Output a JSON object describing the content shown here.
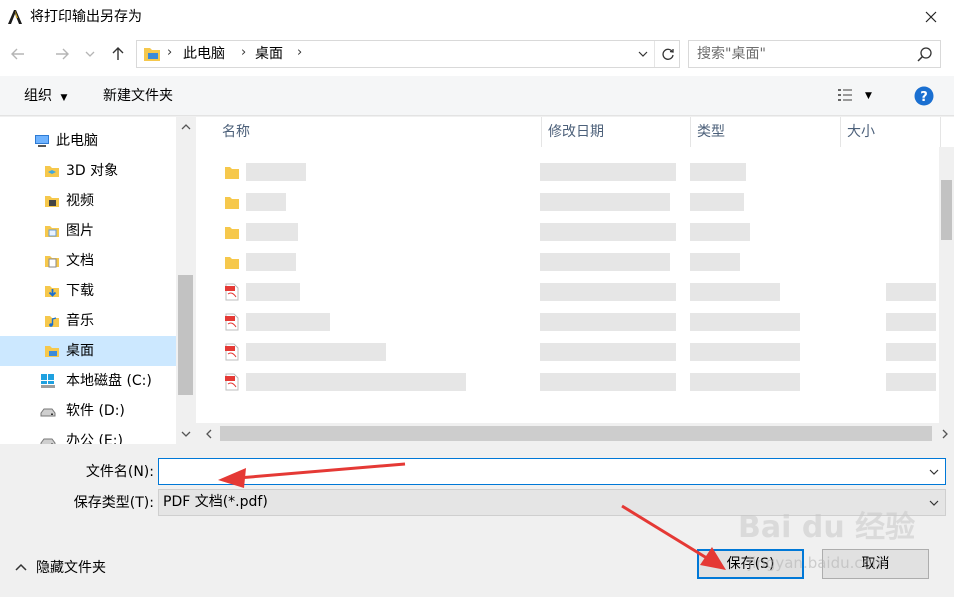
{
  "window": {
    "title": "将打印输出另存为"
  },
  "nav": {
    "breadcrumbs": [
      "此电脑",
      "桌面"
    ],
    "search_placeholder": "搜索\"桌面\""
  },
  "toolbar": {
    "organize": "组织",
    "new_folder": "新建文件夹"
  },
  "sidebar": {
    "items": [
      {
        "label": "此电脑",
        "icon": "computer-icon"
      },
      {
        "label": "3D 对象",
        "icon": "3d-objects-icon"
      },
      {
        "label": "视频",
        "icon": "video-folder-icon"
      },
      {
        "label": "图片",
        "icon": "pictures-folder-icon"
      },
      {
        "label": "文档",
        "icon": "documents-folder-icon"
      },
      {
        "label": "下载",
        "icon": "downloads-folder-icon"
      },
      {
        "label": "音乐",
        "icon": "music-folder-icon"
      },
      {
        "label": "桌面",
        "icon": "desktop-folder-icon",
        "selected": true
      },
      {
        "label": "本地磁盘 (C:)",
        "icon": "windows-drive-icon"
      },
      {
        "label": "软件 (D:)",
        "icon": "drive-icon"
      },
      {
        "label": "办公 (E:)",
        "icon": "drive-icon"
      }
    ]
  },
  "filelist": {
    "columns": [
      "名称",
      "修改日期",
      "类型",
      "大小"
    ],
    "rows": [
      {
        "icon": "folder-icon"
      },
      {
        "icon": "folder-icon"
      },
      {
        "icon": "folder-icon"
      },
      {
        "icon": "folder-icon"
      },
      {
        "icon": "pdf-file-icon"
      },
      {
        "icon": "pdf-file-icon"
      },
      {
        "icon": "pdf-file-icon"
      },
      {
        "icon": "pdf-file-icon"
      }
    ]
  },
  "form": {
    "filename_label": "文件名(N):",
    "filename_value": "",
    "filetype_label": "保存类型(T):",
    "filetype_value": "PDF 文档(*.pdf)"
  },
  "footer": {
    "hide_folders": "隐藏文件夹",
    "save": "保存(S)",
    "cancel": "取消"
  },
  "watermark": {
    "brand": "Bai du 经验",
    "url": "jingyan.baidu.com"
  },
  "colors": {
    "accent": "#0078d7",
    "selected": "#cce8ff",
    "arrow": "#e53935"
  }
}
